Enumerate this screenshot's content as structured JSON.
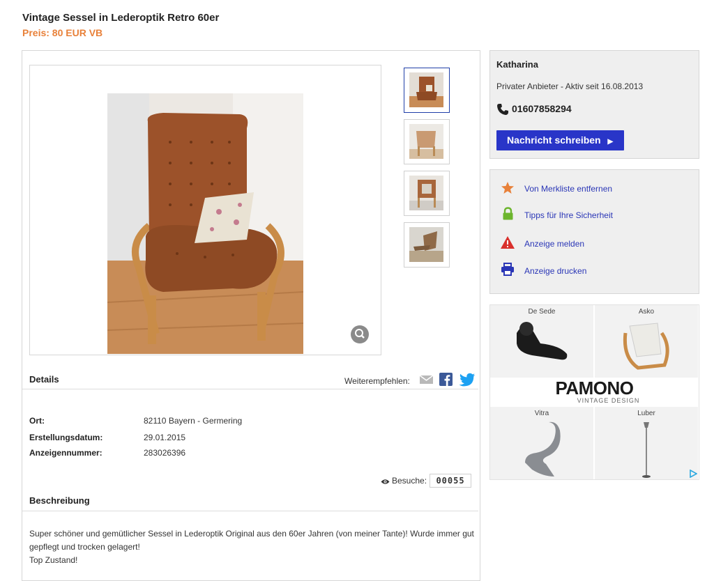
{
  "listing": {
    "title": "Vintage Sessel in Lederoptik Retro 60er",
    "price": "Preis: 80 EUR VB"
  },
  "details": {
    "heading": "Details",
    "share_label": "Weiterempfehlen:",
    "rows": [
      {
        "label": "Ort:",
        "value": "82110 Bayern - Germering"
      },
      {
        "label": "Erstellungsdatum:",
        "value": "29.01.2015"
      },
      {
        "label": "Anzeigennummer:",
        "value": "283026396"
      }
    ],
    "visits_label": "Besuche:",
    "visits_value": "00055"
  },
  "description": {
    "heading": "Beschreibung",
    "line1": "Super schöner und gemütlicher Sessel in Lederoptik Original aus den 60er Jahren (von meiner Tante)! Wurde immer gut",
    "line2": "gepflegt und trocken gelagert!",
    "line3": "Top Zustand!"
  },
  "seller": {
    "name": "Katharina",
    "subtitle": "Privater Anbieter - Aktiv seit 16.08.2013",
    "phone": "01607858294",
    "message_button": "Nachricht schreiben"
  },
  "actions": [
    {
      "label": "Von Merkliste entfernen",
      "icon": "star-icon",
      "color": "#e8813a"
    },
    {
      "label": "Tipps für Ihre Sicherheit",
      "icon": "lock-icon",
      "color": "#6cb52d"
    },
    {
      "label": "Anzeige melden",
      "icon": "warning-icon",
      "color": "#d9302c"
    },
    {
      "label": "Anzeige drucken",
      "icon": "printer-icon",
      "color": "#2a36b6"
    }
  ],
  "ad": {
    "brands": [
      "De Sede",
      "Asko",
      "Vitra",
      "Luber"
    ],
    "logo": "PAMONO",
    "tagline": "VINTAGE DESIGN"
  },
  "colors": {
    "accent": "#e8813a",
    "button": "#2935c8",
    "link": "#2a36b6"
  }
}
